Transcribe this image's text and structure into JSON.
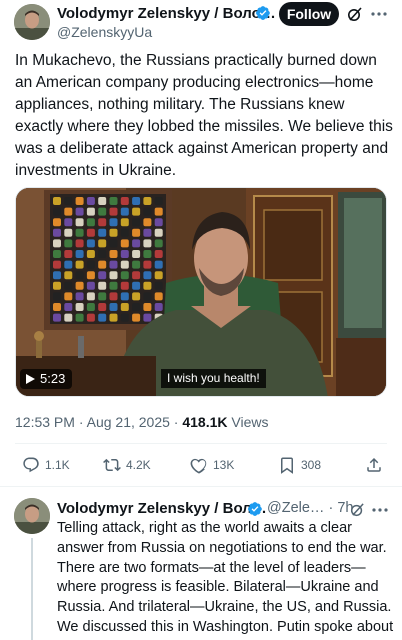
{
  "tweet": {
    "author_name": "Volodymyr Zelenskyy / Воло…",
    "handle": "@ZelenskyyUa",
    "follow_label": "Follow",
    "text": "In Mukachevo, the Russians practically burned down an American company producing electronics—home appliances, nothing military. The Russians knew exactly where they lobbed the missiles. We believe this was a deliberate attack against American property and investments in Ukraine.",
    "video": {
      "duration": "5:23",
      "caption": "I wish you health!"
    },
    "time": "12:53 PM",
    "date": "Aug 21, 2025",
    "views_count": "418.1K",
    "views_label": "Views",
    "replies": "1.1K",
    "reposts": "4.2K",
    "likes": "13K",
    "bookmarks": "308"
  },
  "reply": {
    "author_name": "Volodymyr Zelenskyy / Вол…",
    "handle": "@Zele…",
    "age": "7h",
    "text": "Telling attack, right as the world awaits a clear answer from Russia on negotiations to end the war. There are two formats—at the level of leaders—where progress is feasible. Bilateral—Ukraine and Russia. And trilateral—Ukraine, the US, and Russia. We discussed this in Washington. Putin spoke about it on the call with President Trump."
  },
  "icons": {
    "verified": "verified-badge-icon",
    "grok": "grok-icon",
    "more": "more-icon",
    "reply": "reply-icon",
    "repost": "repost-icon",
    "like": "like-icon",
    "bookmark": "bookmark-icon",
    "share": "share-icon"
  },
  "colors": {
    "text": "#0f1419",
    "secondary": "#536471",
    "verified_blue": "#1d9bf0",
    "follow_bg": "#0f1419"
  }
}
